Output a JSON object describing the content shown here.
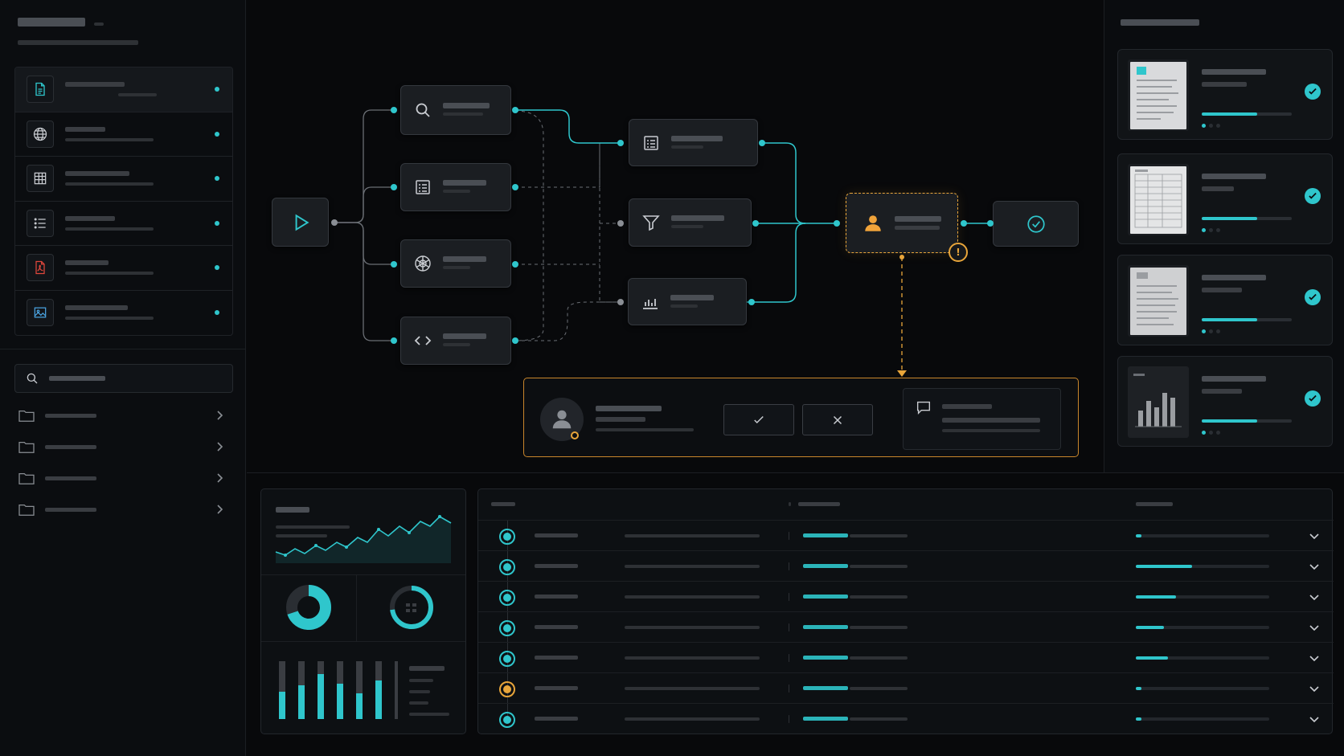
{
  "theme": {
    "accent": "#2fc6cc",
    "warning": "#e8a53a",
    "background": "#08090b"
  },
  "sidebar": {
    "file_items": [
      {
        "icon": "document-icon",
        "active": true
      },
      {
        "icon": "globe-icon",
        "active": false
      },
      {
        "icon": "table-icon",
        "active": false
      },
      {
        "icon": "list-icon",
        "active": false
      },
      {
        "icon": "pdf-icon",
        "active": false
      },
      {
        "icon": "image-icon",
        "active": false
      }
    ],
    "search": {
      "icon": "search-icon"
    },
    "folders": [
      {
        "icon": "folder-icon"
      },
      {
        "icon": "folder-icon"
      },
      {
        "icon": "folder-icon"
      },
      {
        "icon": "folder-icon"
      }
    ]
  },
  "workflow": {
    "nodes": [
      {
        "id": "start",
        "icon": "play-icon"
      },
      {
        "id": "search",
        "icon": "search-icon"
      },
      {
        "id": "form",
        "icon": "form-icon"
      },
      {
        "id": "ai",
        "icon": "openai-icon"
      },
      {
        "id": "code",
        "icon": "code-icon"
      },
      {
        "id": "parse",
        "icon": "list-doc-icon"
      },
      {
        "id": "filter",
        "icon": "filter-icon"
      },
      {
        "id": "chart",
        "icon": "bar-chart-icon"
      },
      {
        "id": "approval",
        "icon": "user-icon",
        "status": "pending"
      },
      {
        "id": "end",
        "icon": "check-circle-icon"
      }
    ]
  },
  "approval_panel": {
    "approve_icon": "check-icon",
    "reject_icon": "close-icon",
    "comment_icon": "comment-icon"
  },
  "documents": [
    {
      "type": "text",
      "progress": 0.62,
      "status": "complete"
    },
    {
      "type": "spreadsheet",
      "progress": 0.62,
      "status": "complete"
    },
    {
      "type": "text",
      "progress": 0.62,
      "status": "complete"
    },
    {
      "type": "chart",
      "progress": 0.62,
      "status": "complete"
    }
  ],
  "table": {
    "rows": [
      {
        "status": "complete",
        "progress": 0.04
      },
      {
        "status": "complete",
        "progress": 0.42
      },
      {
        "status": "complete",
        "progress": 0.3
      },
      {
        "status": "complete",
        "progress": 0.21
      },
      {
        "status": "complete",
        "progress": 0.24
      },
      {
        "status": "pending",
        "progress": 0.04
      },
      {
        "status": "complete",
        "progress": 0.04
      }
    ]
  }
}
